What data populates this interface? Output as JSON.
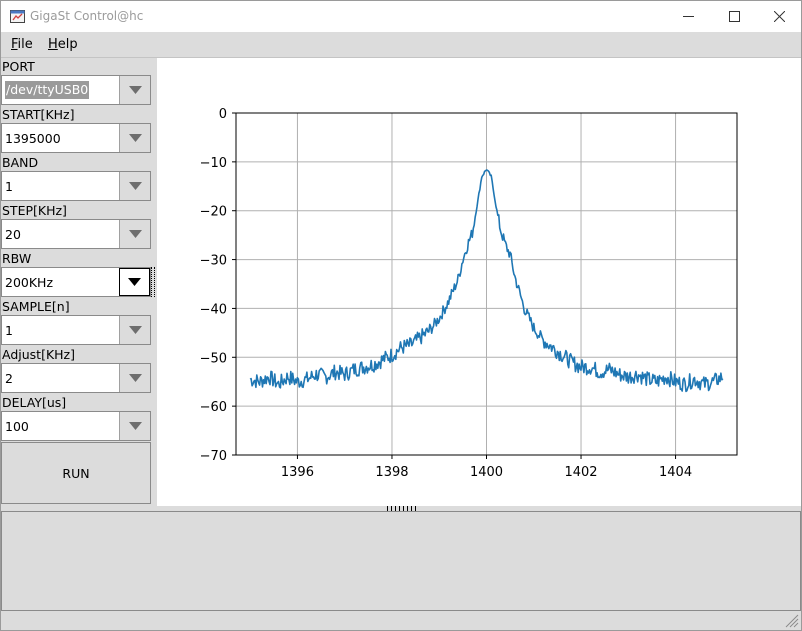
{
  "window": {
    "title": "GigaSt Control@hc"
  },
  "menu": {
    "file_label": "File",
    "help_label": "Help"
  },
  "controls": [
    {
      "label": "PORT",
      "value": "/dev/ttyUSB0",
      "selected": true
    },
    {
      "label": "START[KHz]",
      "value": "1395000"
    },
    {
      "label": "BAND",
      "value": "1"
    },
    {
      "label": "STEP[KHz]",
      "value": "20"
    },
    {
      "label": "RBW",
      "value": "200KHz",
      "active": true
    },
    {
      "label": "SAMPLE[n]",
      "value": "1"
    },
    {
      "label": "Adjust[KHz]",
      "value": "2"
    },
    {
      "label": "DELAY[us]",
      "value": "100"
    }
  ],
  "run_button": {
    "label": "RUN"
  },
  "colors": {
    "line": "#1f77b4",
    "grid": "#b0b0b0",
    "panel": "#dcdcdc"
  },
  "chart_data": {
    "type": "line",
    "title": "",
    "xlabel": "",
    "ylabel": "",
    "xlim": [
      1394.7,
      1405.3
    ],
    "ylim": [
      -70,
      0
    ],
    "xticks": [
      1396,
      1398,
      1400,
      1402,
      1404
    ],
    "yticks": [
      0,
      -10,
      -20,
      -30,
      -40,
      -50,
      -60,
      -70
    ],
    "grid": true,
    "legend": "none",
    "series": [
      {
        "x": [
          1395.0,
          1395.2,
          1395.4,
          1395.6,
          1395.8,
          1396.0,
          1396.2,
          1396.4,
          1396.6,
          1396.8,
          1397.0,
          1397.2,
          1397.4,
          1397.6,
          1397.8,
          1398.0,
          1398.2,
          1398.4,
          1398.6,
          1398.8,
          1399.0,
          1399.2,
          1399.4,
          1399.5,
          1399.6,
          1399.7,
          1399.8,
          1399.9,
          1400.0,
          1400.1,
          1400.2,
          1400.3,
          1400.4,
          1400.5,
          1400.6,
          1400.8,
          1401.0,
          1401.2,
          1401.4,
          1401.6,
          1401.8,
          1402.0,
          1402.2,
          1402.4,
          1402.6,
          1402.8,
          1403.0,
          1403.2,
          1403.4,
          1403.6,
          1403.8,
          1404.0,
          1404.2,
          1404.4,
          1404.6,
          1404.8,
          1405.0
        ],
        "y": [
          -54.5,
          -55.0,
          -54.0,
          -55.5,
          -54.0,
          -55.0,
          -54.5,
          -53.5,
          -54.0,
          -53.0,
          -53.5,
          -52.5,
          -52.0,
          -51.5,
          -50.5,
          -49.5,
          -48.0,
          -47.5,
          -46.0,
          -44.5,
          -42.0,
          -38.5,
          -34.0,
          -30.0,
          -27.0,
          -24.5,
          -19.0,
          -13.0,
          -11.5,
          -13.0,
          -19.0,
          -24.0,
          -27.0,
          -29.0,
          -33.5,
          -40.0,
          -44.0,
          -46.5,
          -48.0,
          -49.5,
          -51.0,
          -52.0,
          -52.0,
          -53.0,
          -52.5,
          -53.5,
          -54.0,
          -53.5,
          -54.5,
          -55.0,
          -54.0,
          -55.0,
          -55.5,
          -54.5,
          -55.5,
          -55.0,
          -54.0
        ]
      }
    ]
  }
}
